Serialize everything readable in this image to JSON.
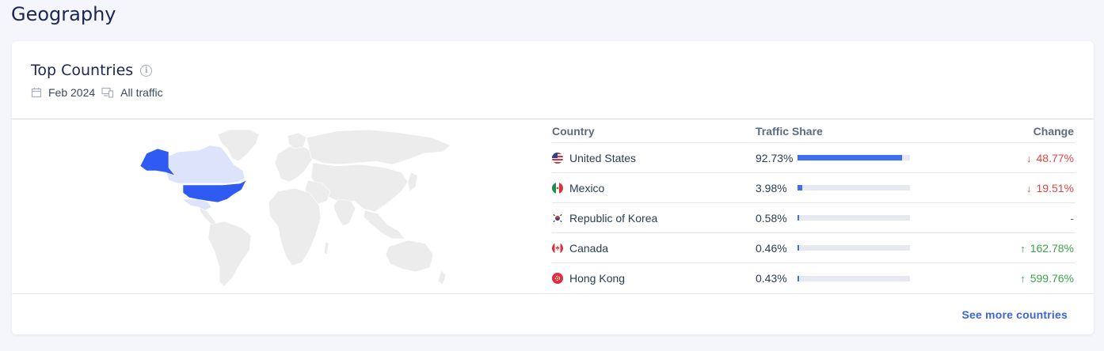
{
  "section": {
    "title": "Geography"
  },
  "card": {
    "title": "Top Countries",
    "info_icon": "info-icon",
    "meta": {
      "date": "Feb 2024",
      "traffic": "All traffic"
    }
  },
  "table": {
    "headers": {
      "country": "Country",
      "share": "Traffic Share",
      "change": "Change"
    },
    "rows": [
      {
        "country": "United States",
        "flag": "us-flag-icon",
        "share": "92.73%",
        "share_value": 0.9273,
        "change": "48.77%",
        "direction": "down"
      },
      {
        "country": "Mexico",
        "flag": "mx-flag-icon",
        "share": "3.98%",
        "share_value": 0.0398,
        "change": "19.51%",
        "direction": "down"
      },
      {
        "country": "Republic of Korea",
        "flag": "kr-flag-icon",
        "share": "0.58%",
        "share_value": 0.0058,
        "change": "-",
        "direction": "none"
      },
      {
        "country": "Canada",
        "flag": "ca-flag-icon",
        "share": "0.46%",
        "share_value": 0.0046,
        "change": "162.78%",
        "direction": "up"
      },
      {
        "country": "Hong Kong",
        "flag": "hk-flag-icon",
        "share": "0.43%",
        "share_value": 0.0043,
        "change": "599.76%",
        "direction": "up"
      }
    ]
  },
  "see_more": "See more countries",
  "colors": {
    "accent": "#3f6ef0",
    "negative": "#e54545",
    "positive": "#3aa54a",
    "link": "#3d64d8"
  }
}
